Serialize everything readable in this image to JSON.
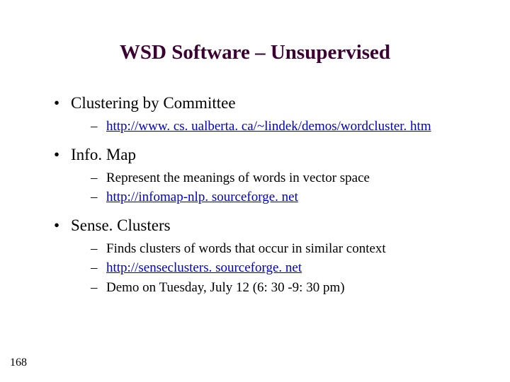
{
  "title": "WSD Software – Unsupervised",
  "page_number": "168",
  "items": [
    {
      "label": "Clustering by Committee",
      "sub": [
        {
          "text": "http://www. cs. ualberta. ca/~lindek/demos/wordcluster. htm",
          "link": true
        }
      ]
    },
    {
      "label": "Info. Map",
      "sub": [
        {
          "text": "Represent the meanings of words in vector space",
          "link": false
        },
        {
          "text": "http://infomap-nlp. sourceforge. net",
          "link": true
        }
      ]
    },
    {
      "label": "Sense. Clusters",
      "sub": [
        {
          "text": "Finds clusters of words that occur in similar context",
          "link": false
        },
        {
          "text": "http://senseclusters. sourceforge. net",
          "link": true
        },
        {
          "text": "Demo on Tuesday, July 12 (6: 30 -9: 30 pm)",
          "link": false
        }
      ]
    }
  ]
}
